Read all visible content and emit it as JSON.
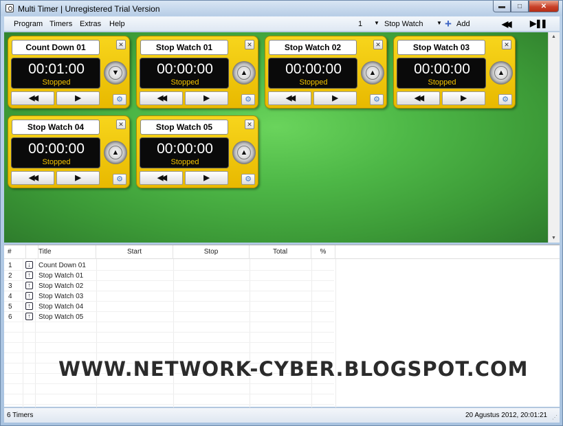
{
  "window": {
    "title": "Multi Timer | Unregistered Trial Version",
    "minimize": "▬",
    "maximize": "□",
    "close": "✕"
  },
  "menu": [
    "Program",
    "Timers",
    "Extras",
    "Help"
  ],
  "toolbar": {
    "count": "1",
    "type": "Stop Watch",
    "add_label": "Add",
    "plus": "+",
    "dropdown_arrow": "▼",
    "rewind_all": "◀◀",
    "play_pause_all": "▶❚❚"
  },
  "card_controls": {
    "rewind": "◀◀",
    "play": "▶",
    "gear": "⚙",
    "close": "✕"
  },
  "timers": [
    {
      "title": "Count Down 01",
      "time": "00:01:00",
      "status": "Stopped",
      "direction": "▼"
    },
    {
      "title": "Stop Watch 01",
      "time": "00:00:00",
      "status": "Stopped",
      "direction": "▲"
    },
    {
      "title": "Stop Watch 02",
      "time": "00:00:00",
      "status": "Stopped",
      "direction": "▲"
    },
    {
      "title": "Stop Watch 03",
      "time": "00:00:00",
      "status": "Stopped",
      "direction": "▲"
    },
    {
      "title": "Stop Watch 04",
      "time": "00:00:00",
      "status": "Stopped",
      "direction": "▲"
    },
    {
      "title": "Stop Watch 05",
      "time": "00:00:00",
      "status": "Stopped",
      "direction": "▲"
    }
  ],
  "list": {
    "columns": [
      "#",
      "Title",
      "Start",
      "Stop",
      "Total",
      "%"
    ],
    "rows": [
      {
        "num": "1",
        "icon": "↓",
        "title": "Count Down 01"
      },
      {
        "num": "2",
        "icon": "↑",
        "title": "Stop Watch 01"
      },
      {
        "num": "3",
        "icon": "↑",
        "title": "Stop Watch 02"
      },
      {
        "num": "4",
        "icon": "↑",
        "title": "Stop Watch 03"
      },
      {
        "num": "5",
        "icon": "↑",
        "title": "Stop Watch 04"
      },
      {
        "num": "6",
        "icon": "↑",
        "title": "Stop Watch 05"
      }
    ]
  },
  "watermark": "WWW.NETWORK-CYBER.BLOGSPOT.COM",
  "status": {
    "left": "6 Timers",
    "right": "20 Agustus 2012, 20:01:21"
  },
  "colors": {
    "card_yellow": "#f2c80c",
    "display_black": "#0a0a0a",
    "status_yellow": "#f5c400",
    "board_green": "#4eb847"
  }
}
